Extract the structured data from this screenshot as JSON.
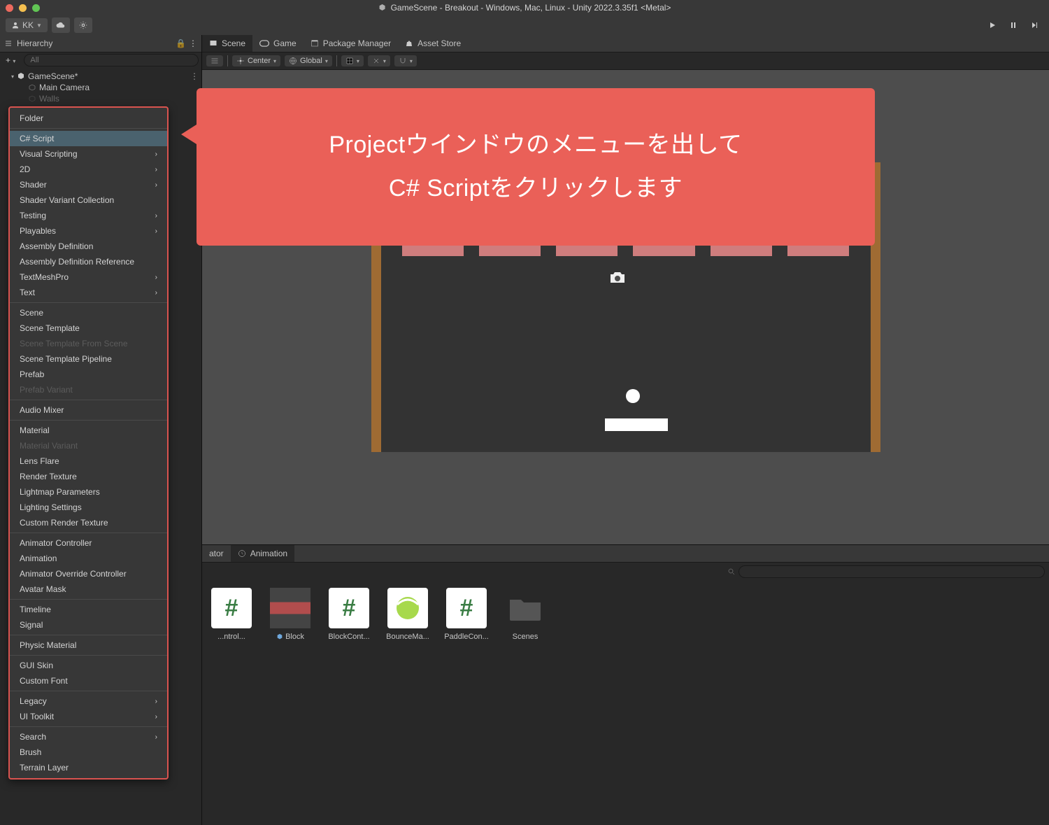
{
  "title": "GameScene - Breakout - Windows, Mac, Linux - Unity 2022.3.35f1 <Metal>",
  "account_label": "KK",
  "hierarchy": {
    "panel_title": "Hierarchy",
    "search_placeholder": "All",
    "scene_node": "GameScene*",
    "child1": "Main Camera",
    "child2": "Walls"
  },
  "tabs": {
    "scene": "Scene",
    "game": "Game",
    "package": "Package Manager",
    "asset_store": "Asset Store",
    "animator_tail": "ator",
    "animation": "Animation"
  },
  "scene_toolbar": {
    "center": "Center",
    "global": "Global"
  },
  "callout_line1": "Projectウインドウのメニューを出して",
  "callout_line2": "C# Scriptをクリックします",
  "context_menu": [
    {
      "label": "Folder",
      "type": "item"
    },
    {
      "type": "sep"
    },
    {
      "label": "C# Script",
      "type": "item",
      "highlight": true
    },
    {
      "label": "Visual Scripting",
      "type": "sub"
    },
    {
      "label": "2D",
      "type": "sub"
    },
    {
      "label": "Shader",
      "type": "sub"
    },
    {
      "label": "Shader Variant Collection",
      "type": "item"
    },
    {
      "label": "Testing",
      "type": "sub"
    },
    {
      "label": "Playables",
      "type": "sub"
    },
    {
      "label": "Assembly Definition",
      "type": "item"
    },
    {
      "label": "Assembly Definition Reference",
      "type": "item"
    },
    {
      "label": "TextMeshPro",
      "type": "sub"
    },
    {
      "label": "Text",
      "type": "sub"
    },
    {
      "type": "sep"
    },
    {
      "label": "Scene",
      "type": "item"
    },
    {
      "label": "Scene Template",
      "type": "item"
    },
    {
      "label": "Scene Template From Scene",
      "type": "item",
      "disabled": true
    },
    {
      "label": "Scene Template Pipeline",
      "type": "item"
    },
    {
      "label": "Prefab",
      "type": "item"
    },
    {
      "label": "Prefab Variant",
      "type": "item",
      "disabled": true
    },
    {
      "type": "sep"
    },
    {
      "label": "Audio Mixer",
      "type": "item"
    },
    {
      "type": "sep"
    },
    {
      "label": "Material",
      "type": "item"
    },
    {
      "label": "Material Variant",
      "type": "item",
      "disabled": true
    },
    {
      "label": "Lens Flare",
      "type": "item"
    },
    {
      "label": "Render Texture",
      "type": "item"
    },
    {
      "label": "Lightmap Parameters",
      "type": "item"
    },
    {
      "label": "Lighting Settings",
      "type": "item"
    },
    {
      "label": "Custom Render Texture",
      "type": "item"
    },
    {
      "type": "sep"
    },
    {
      "label": "Animator Controller",
      "type": "item"
    },
    {
      "label": "Animation",
      "type": "item"
    },
    {
      "label": "Animator Override Controller",
      "type": "item"
    },
    {
      "label": "Avatar Mask",
      "type": "item"
    },
    {
      "type": "sep"
    },
    {
      "label": "Timeline",
      "type": "item"
    },
    {
      "label": "Signal",
      "type": "item"
    },
    {
      "type": "sep"
    },
    {
      "label": "Physic Material",
      "type": "item"
    },
    {
      "type": "sep"
    },
    {
      "label": "GUI Skin",
      "type": "item"
    },
    {
      "label": "Custom Font",
      "type": "item"
    },
    {
      "type": "sep"
    },
    {
      "label": "Legacy",
      "type": "sub"
    },
    {
      "label": "UI Toolkit",
      "type": "sub"
    },
    {
      "type": "sep"
    },
    {
      "label": "Search",
      "type": "sub"
    },
    {
      "label": "Brush",
      "type": "item"
    },
    {
      "label": "Terrain Layer",
      "type": "item"
    }
  ],
  "assets": [
    {
      "name": "...ntrol...",
      "kind": "script"
    },
    {
      "name": "Block",
      "kind": "prefab"
    },
    {
      "name": "BlockCont...",
      "kind": "script"
    },
    {
      "name": "BounceMa...",
      "kind": "physmat"
    },
    {
      "name": "PaddleCon...",
      "kind": "script"
    },
    {
      "name": "Scenes",
      "kind": "folder"
    }
  ],
  "colors": {
    "border": "#d9534f",
    "callout": "#ea6058",
    "brick": "#cf7d7d",
    "frame": "#9f6b33"
  }
}
